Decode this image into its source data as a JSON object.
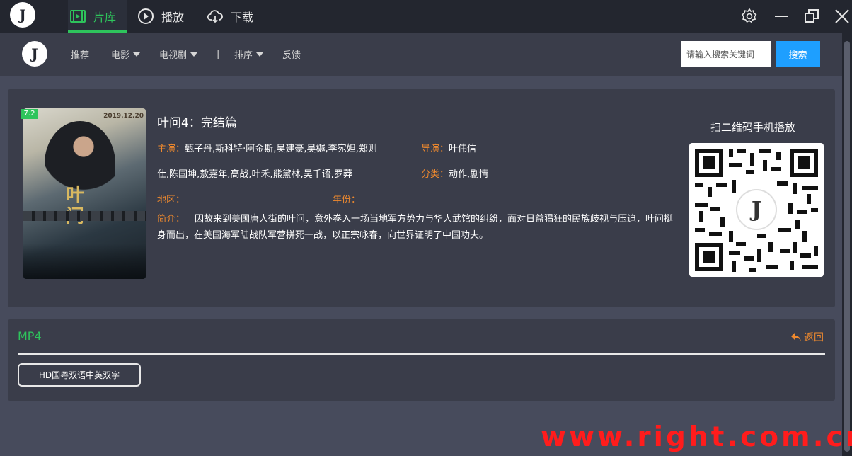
{
  "app": {
    "logo_text": "J",
    "tabs": [
      {
        "label": "片库",
        "icon": "library-icon",
        "active": true
      },
      {
        "label": "播放",
        "icon": "play-circle-icon",
        "active": false
      },
      {
        "label": "下载",
        "icon": "cloud-download-icon",
        "active": false
      }
    ],
    "window_controls": [
      "settings-icon",
      "minimize-icon",
      "restore-icon",
      "close-icon"
    ]
  },
  "nav": {
    "logo_text": "J",
    "items": [
      {
        "label": "推荐",
        "dropdown": false
      },
      {
        "label": "电影",
        "dropdown": true
      },
      {
        "label": "电视剧",
        "dropdown": true
      },
      {
        "label": "|",
        "dropdown": false
      },
      {
        "label": "排序",
        "dropdown": true
      },
      {
        "label": "反馈",
        "dropdown": false
      }
    ],
    "search": {
      "placeholder": "请输入搜索关键词",
      "value": "",
      "button_label": "搜索"
    }
  },
  "detail": {
    "rating": "7.2",
    "poster_date": "2019.12.20",
    "poster_title": "叶问",
    "title": "叶问4：完结篇",
    "cast_label": "主演：",
    "cast_line1": "甄子丹,斯科特·阿金斯,吴建豪,吴樾,李宛妲,郑则",
    "cast_line2": "仕,陈国坤,敖嘉年,高战,叶禾,熊黛林,吴千语,罗莽",
    "director_label": "导演：",
    "director": "叶伟信",
    "genre_label": "分类：",
    "genre": "动作,剧情",
    "region_label": "地区：",
    "region": "",
    "year_label": "年份：",
    "year": "",
    "synopsis_label": "简介：",
    "synopsis": "因故来到美国唐人街的叶问，意外卷入一场当地军方势力与华人武馆的纠纷，面对日益猖狂的民族歧视与压迫，叶问挺身而出，在美国海军陆战队军营拼死一战，以正宗咏春，向世界证明了中国功夫。",
    "qr_title": "扫二维码手机播放"
  },
  "sources": {
    "title": "MP4",
    "back_label": "返回",
    "episodes": [
      "HD国粤双语中英双字"
    ]
  },
  "watermark": "www.right.com.cn",
  "colors": {
    "accent_green": "#2ec45c",
    "label_orange": "#f08a2e",
    "search_blue": "#1e9fff",
    "watermark_red": "#ff1c1c"
  }
}
